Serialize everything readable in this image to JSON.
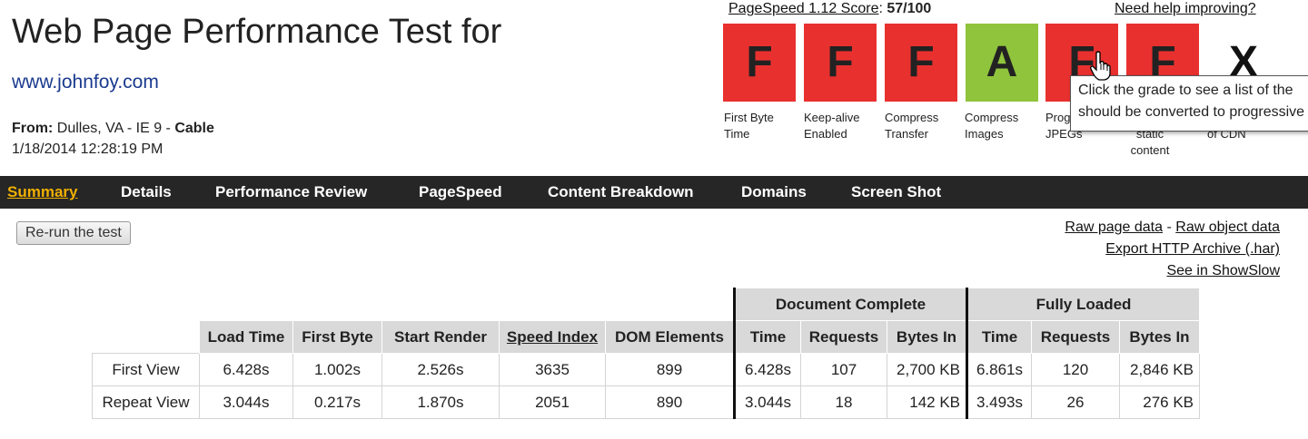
{
  "header": {
    "title": "Web Page Performance Test for",
    "site_url": "www.johnfoy.com",
    "from_label": "From:",
    "from_location": "Dulles, VA - IE 9 -",
    "connection": "Cable",
    "datetime": "1/18/2014 12:28:19 PM"
  },
  "pagespeed": {
    "score_label": "PageSpeed 1.12 Score",
    "score_value": "57/100",
    "help_link": "Need help improving?"
  },
  "grades": [
    {
      "letter": "F",
      "label": "First Byte Time",
      "color": "#e8312f"
    },
    {
      "letter": "F",
      "label": "Keep-alive Enabled",
      "color": "#e8312f"
    },
    {
      "letter": "F",
      "label": "Compress Transfer",
      "color": "#e8312f"
    },
    {
      "letter": "A",
      "label": "Compress Images",
      "color": "#8fc43c"
    },
    {
      "letter": "F",
      "label": "Progressive JPEGs",
      "color": "#e8312f"
    },
    {
      "letter": "F",
      "label": "Cache static content",
      "color": "#e8312f"
    },
    {
      "letter": "X",
      "label": "Effective use of CDN",
      "color": "none"
    }
  ],
  "tooltip": {
    "line1": "Click the grade to see a list of the",
    "line2": "should be converted to progressive"
  },
  "nav": {
    "items": [
      "Summary",
      "Details",
      "Performance Review",
      "PageSpeed",
      "Content Breakdown",
      "Domains",
      "Screen Shot"
    ],
    "active": "Summary"
  },
  "actions": {
    "rerun_label": "Re-run the test",
    "raw_page_data": "Raw page data",
    "dash": "-",
    "raw_object_data": "Raw object data",
    "export_har": "Export HTTP Archive (.har)",
    "showslow": "See in ShowSlow"
  },
  "results": {
    "group_document": "Document Complete",
    "group_fully": "Fully Loaded",
    "columns": [
      "Load Time",
      "First Byte",
      "Start Render",
      "Speed Index",
      "DOM Elements",
      "Time",
      "Requests",
      "Bytes In",
      "Time",
      "Requests",
      "Bytes In"
    ],
    "rows": [
      {
        "label": "First View",
        "cells": [
          "6.428s",
          "1.002s",
          "2.526s",
          "3635",
          "899",
          "6.428s",
          "107",
          "2,700 KB",
          "6.861s",
          "120",
          "2,846 KB"
        ]
      },
      {
        "label": "Repeat View",
        "cells": [
          "3.044s",
          "0.217s",
          "1.870s",
          "2051",
          "890",
          "3.044s",
          "18",
          "142 KB",
          "3.493s",
          "26",
          "276 KB"
        ]
      }
    ]
  }
}
